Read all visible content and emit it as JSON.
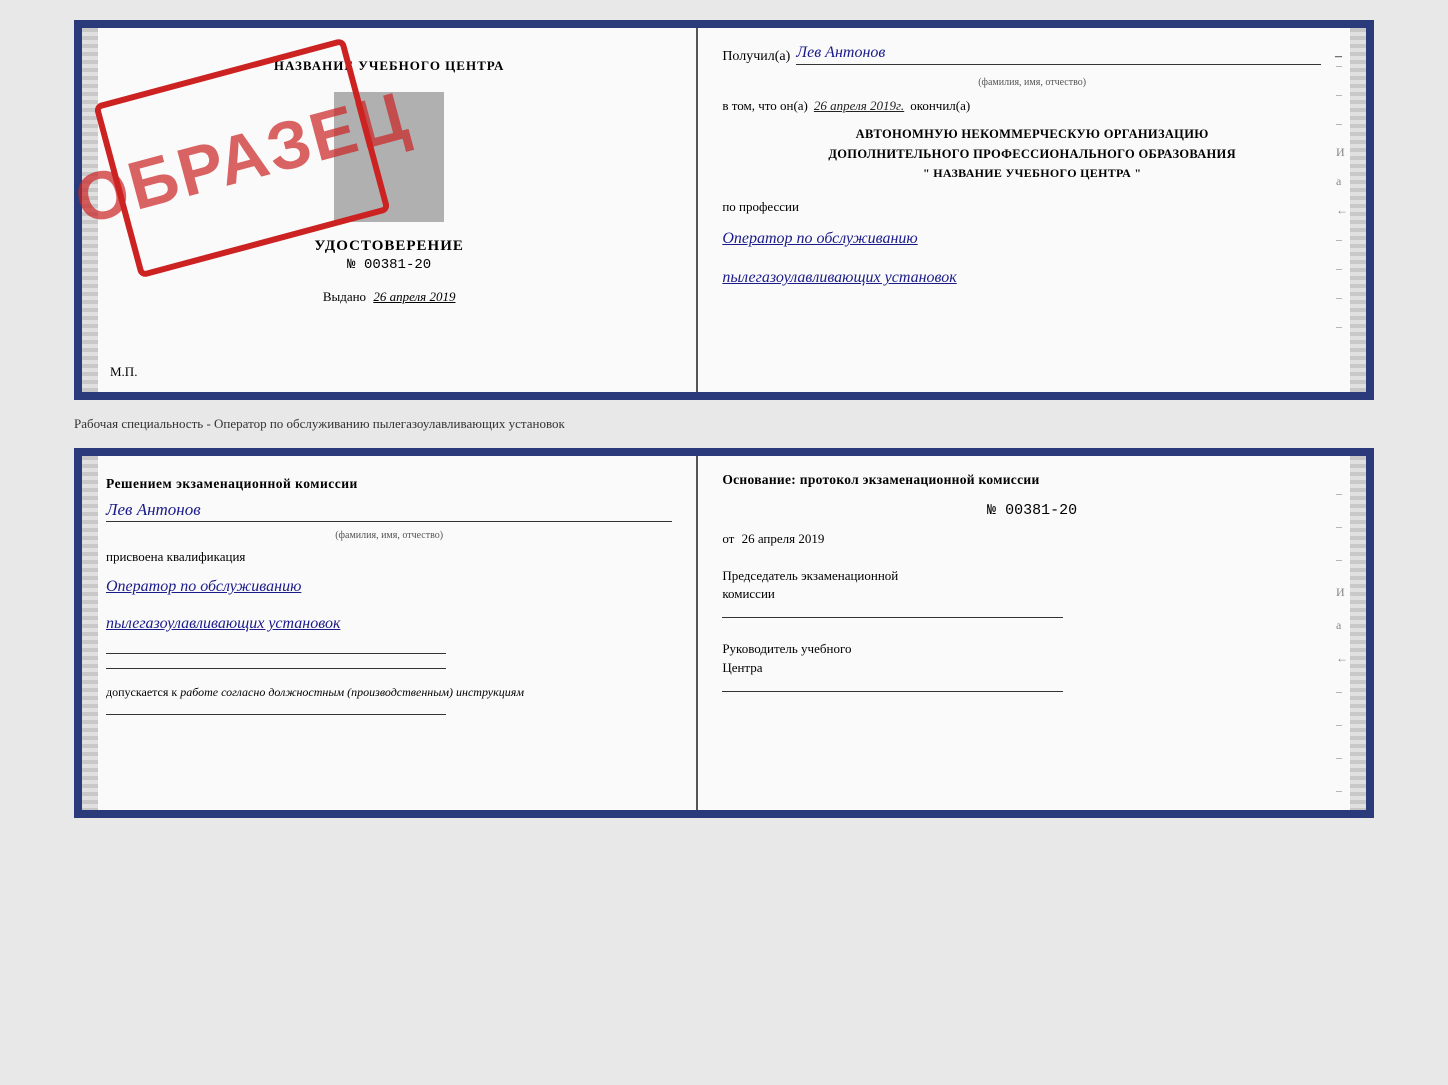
{
  "top_cert": {
    "left": {
      "training_center": "НАЗВАНИЕ УЧЕБНОГО ЦЕНТРА",
      "udostoverenie": "УДОСТОВЕРЕНИЕ",
      "number": "№ 00381-20",
      "vydano_label": "Выдано",
      "vydano_date": "26 апреля 2019",
      "mp": "М.П.",
      "obrazec": "ОБРАЗЕЦ"
    },
    "right": {
      "poluchil_label": "Получил(а)",
      "poluchil_name": "Лев Антонов",
      "fio_sub": "(фамилия, имя, отчество)",
      "vtom_label": "в том, что он(а)",
      "vtom_date": "26 апреля 2019г.",
      "okonchil": "окончил(а)",
      "org_line1": "АВТОНОМНУЮ НЕКОММЕРЧЕСКУЮ ОРГАНИЗАЦИЮ",
      "org_line2": "ДОПОЛНИТЕЛЬНОГО ПРОФЕССИОНАЛЬНОГО ОБРАЗОВАНИЯ",
      "org_quotes": "\" НАЗВАНИЕ УЧЕБНОГО ЦЕНТРА \"",
      "po_professii": "по профессии",
      "profession1": "Оператор по обслуживанию",
      "profession2": "пылегазоулавливающих установок",
      "dashes": [
        "-",
        "-",
        "-",
        "И",
        "а",
        "←",
        "-",
        "-",
        "-",
        "-"
      ]
    }
  },
  "middle": {
    "text": "Рабочая специальность - Оператор по обслуживанию пылегазоулавливающих установок"
  },
  "bottom_cert": {
    "left": {
      "resheniem": "Решением экзаменационной комиссии",
      "name": "Лев Антонов",
      "fio_sub": "(фамилия, имя, отчество)",
      "prisvoyena": "присвоена квалификация",
      "profession1": "Оператор по обслуживанию",
      "profession2": "пылегазоулавливающих установок",
      "dopuskaetsya": "допускается к",
      "dopuskaetsya_italic": "работе согласно должностным (производственным) инструкциям"
    },
    "right": {
      "osnovanie": "Основание: протокол экзаменационной комиссии",
      "protocol_number": "№ 00381-20",
      "ot_label": "от",
      "ot_date": "26 апреля 2019",
      "predsedatel_line1": "Председатель экзаменационной",
      "predsedatel_line2": "комиссии",
      "rukovoditel_line1": "Руководитель учебного",
      "rukovoditel_line2": "Центра",
      "dashes": [
        "-",
        "-",
        "-",
        "И",
        "а",
        "←",
        "-",
        "-",
        "-",
        "-"
      ]
    }
  }
}
